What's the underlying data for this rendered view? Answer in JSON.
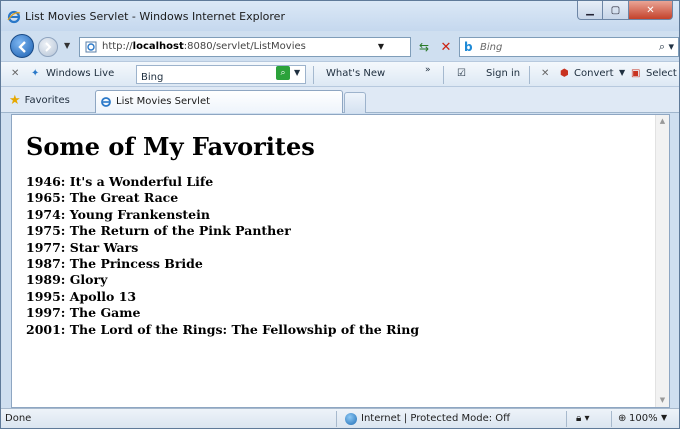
{
  "window": {
    "title": "List Movies Servlet - Windows Internet Explorer"
  },
  "address_bar": {
    "url_prefix": "http://",
    "url_host": "localhost",
    "url_rest": ":8080/servlet/ListMovies"
  },
  "search": {
    "placeholder": "Bing"
  },
  "toolbar": {
    "windows_live_label": "Windows Live",
    "search_value": "Bing",
    "whats_new_label": "What's New",
    "sign_in_label": "Sign in",
    "convert_label": "Convert",
    "select_label": "Select"
  },
  "favorites": {
    "favorites_label": "Favorites",
    "active_tab_label": "List Movies Servlet"
  },
  "page": {
    "heading": "Some of My Favorites",
    "movies": [
      "1946: It's a Wonderful Life",
      "1965: The Great Race",
      "1974: Young Frankenstein",
      "1975: The Return of the Pink Panther",
      "1977: Star Wars",
      "1987: The Princess Bride",
      "1989: Glory",
      "1995: Apollo 13",
      "1997: The Game",
      "2001: The Lord of the Rings: The Fellowship of the Ring"
    ]
  },
  "status_bar": {
    "status_text": "Done",
    "zone_text": "Internet | Protected Mode: Off",
    "zoom_text": "100%"
  },
  "colors": {
    "close_button": "#c4422b",
    "window_frame": "#cfdff0",
    "accent_blue": "#1f6db5"
  }
}
